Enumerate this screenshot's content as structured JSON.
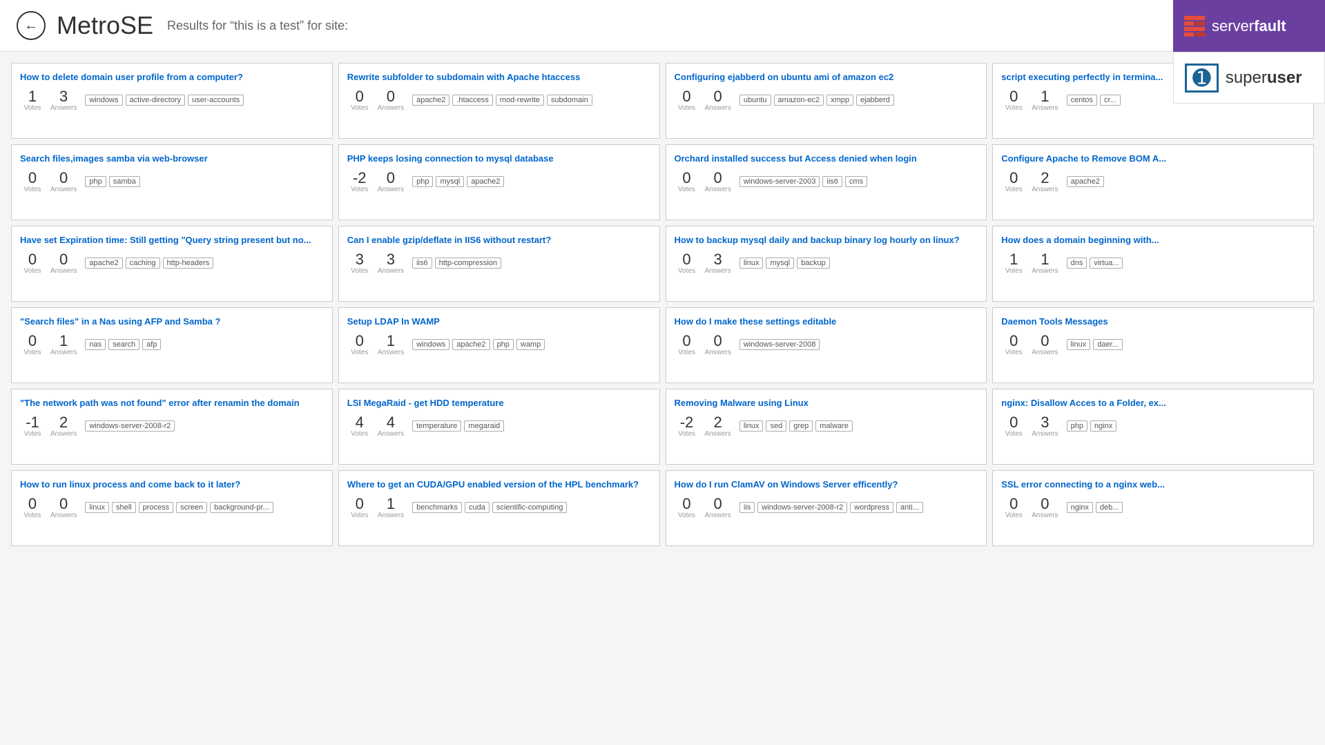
{
  "header": {
    "back_label": "←",
    "app_title": "MetroSE",
    "search_result_prefix": "Results for “this is a test” for site:"
  },
  "logos": {
    "serverfault_label": "serverfault",
    "superuser_label": "superuser"
  },
  "results": [
    {
      "title": "How to delete domain user profile from a computer?",
      "votes": "1",
      "answers": "3",
      "tags": [
        "windows",
        "active-directory",
        "user-accounts"
      ]
    },
    {
      "title": "Rewrite subfolder to subdomain with Apache htaccess",
      "votes": "0",
      "answers": "0",
      "tags": [
        "apache2",
        ".htaccess",
        "mod-rewrite",
        "subdomain"
      ]
    },
    {
      "title": "Configuring ejabberd on ubuntu ami of amazon ec2",
      "votes": "0",
      "answers": "0",
      "tags": [
        "ubuntu",
        "amazon-ec2",
        "xmpp",
        "ejabberd"
      ]
    },
    {
      "title": "script executing perfectly in termina...",
      "votes": "0",
      "answers": "1",
      "tags": [
        "centos",
        "cr..."
      ]
    },
    {
      "title": "Search files,images samba via web-browser",
      "votes": "0",
      "answers": "0",
      "tags": [
        "php",
        "samba"
      ]
    },
    {
      "title": "PHP keeps losing connection to mysql database",
      "votes": "-2",
      "answers": "0",
      "tags": [
        "php",
        "mysql",
        "apache2"
      ]
    },
    {
      "title": "Orchard installed success but Access denied when login",
      "votes": "0",
      "answers": "0",
      "tags": [
        "windows-server-2003",
        "iis6",
        "cms"
      ]
    },
    {
      "title": "Configure Apache to Remove BOM A...",
      "votes": "0",
      "answers": "2",
      "tags": [
        "apache2"
      ]
    },
    {
      "title": "Have set Expiration time: Still getting \"Query string present but no...",
      "votes": "0",
      "answers": "0",
      "tags": [
        "apache2",
        "caching",
        "http-headers"
      ]
    },
    {
      "title": "Can I enable gzip/deflate in IIS6 without restart?",
      "votes": "3",
      "answers": "3",
      "tags": [
        "iis6",
        "http-compression"
      ]
    },
    {
      "title": "How to backup mysql daily and backup binary log hourly on linux?",
      "votes": "0",
      "answers": "3",
      "tags": [
        "linux",
        "mysql",
        "backup"
      ]
    },
    {
      "title": "How does a domain beginning with...",
      "votes": "1",
      "answers": "1",
      "tags": [
        "dns",
        "virtua..."
      ]
    },
    {
      "title": "\"Search files\" in a Nas using AFP and Samba ?",
      "votes": "0",
      "answers": "1",
      "tags": [
        "nas",
        "search",
        "afp"
      ]
    },
    {
      "title": "Setup LDAP In WAMP",
      "votes": "0",
      "answers": "1",
      "tags": [
        "windows",
        "apache2",
        "php",
        "wamp"
      ]
    },
    {
      "title": "How do I make these settings editable",
      "votes": "0",
      "answers": "0",
      "tags": [
        "windows-server-2008"
      ]
    },
    {
      "title": "Daemon Tools Messages",
      "votes": "0",
      "answers": "0",
      "tags": [
        "linux",
        "daer..."
      ]
    },
    {
      "title": "\"The network path was not found\" error after renamin the domain",
      "votes": "-1",
      "answers": "2",
      "tags": [
        "windows-server-2008-r2"
      ]
    },
    {
      "title": "LSI MegaRaid - get HDD temperature",
      "votes": "4",
      "answers": "4",
      "tags": [
        "temperature",
        "megaraid"
      ]
    },
    {
      "title": "Removing Malware using Linux",
      "votes": "-2",
      "answers": "2",
      "tags": [
        "linux",
        "sed",
        "grep",
        "malware"
      ]
    },
    {
      "title": "nginx: Disallow Acces to a Folder, ex...",
      "votes": "0",
      "answers": "3",
      "tags": [
        "php",
        "nginx"
      ]
    },
    {
      "title": "How to run linux process and come back to it later?",
      "votes": "0",
      "answers": "0",
      "tags": [
        "linux",
        "shell",
        "process",
        "screen",
        "background-pr..."
      ]
    },
    {
      "title": "Where to get an CUDA/GPU enabled version of the HPL benchmark?",
      "votes": "0",
      "answers": "1",
      "tags": [
        "benchmarks",
        "cuda",
        "scientific-computing"
      ]
    },
    {
      "title": "How do I run ClamAV on Windows Server efficently?",
      "votes": "0",
      "answers": "0",
      "tags": [
        "iis",
        "windows-server-2008-r2",
        "wordpress",
        "anti..."
      ]
    },
    {
      "title": "SSL error connecting to a nginx web...",
      "votes": "0",
      "answers": "0",
      "tags": [
        "nginx",
        "deb..."
      ]
    }
  ],
  "labels": {
    "votes": "Votes",
    "answers": "Answers"
  }
}
